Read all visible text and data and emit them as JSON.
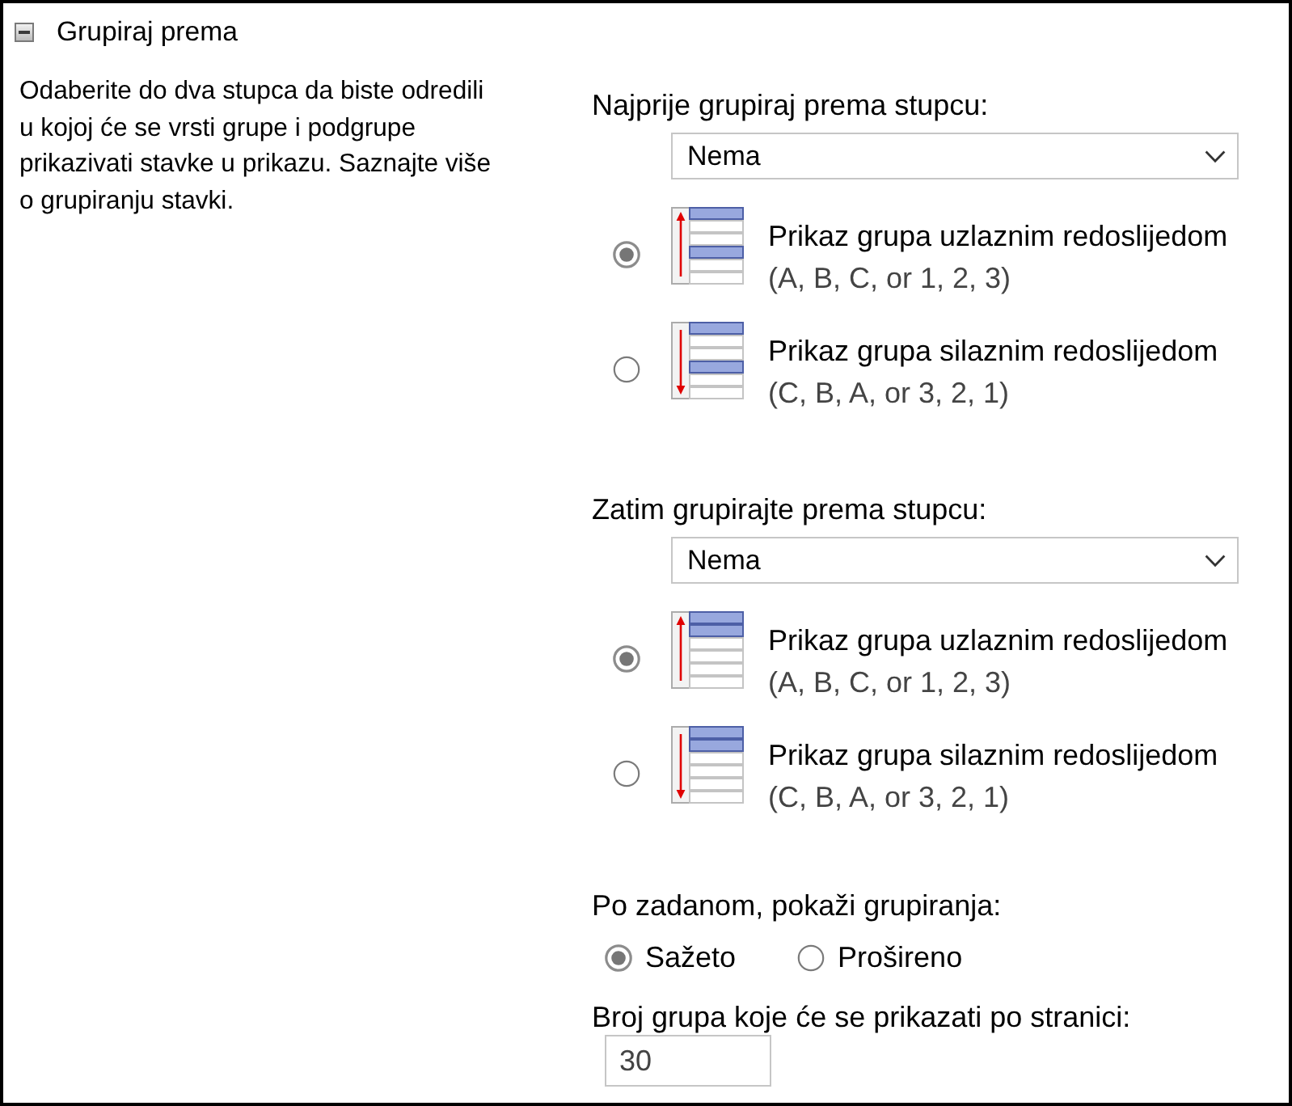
{
  "group": {
    "title": "Grupiraj prema",
    "expanded": true,
    "description": "Odaberite do dva stupca da biste odredili u kojoj će se vrsti grupe i podgrupe prikazivati stavke u prikazu. Saznajte više o grupiranju stavki."
  },
  "sections": [
    {
      "kind": "primary",
      "label": "Najprije grupiraj prema stupcu:",
      "dropdown": {
        "value": "Nema"
      },
      "options": [
        {
          "kind": "ascending",
          "selected": true,
          "label": "Prikaz grupa uzlaznim redoslijedom",
          "hint": "(A, B, C, or 1, 2, 3)"
        },
        {
          "kind": "descending",
          "selected": false,
          "label": "Prikaz grupa silaznim redoslijedom",
          "hint": "(C, B, A, or 3, 2, 1)"
        }
      ]
    },
    {
      "kind": "secondary",
      "label": "Zatim grupirajte prema stupcu:",
      "dropdown": {
        "value": "Nema"
      },
      "options": [
        {
          "kind": "ascending",
          "selected": true,
          "label": "Prikaz grupa uzlaznim redoslijedom",
          "hint": "(A, B, C, or 1, 2, 3)"
        },
        {
          "kind": "descending",
          "selected": false,
          "label": "Prikaz grupa silaznim redoslijedom",
          "hint": "(C, B, A, or 3, 2, 1)"
        }
      ]
    }
  ],
  "default_display": {
    "label": "Po zadanom, pokaži grupiranja:",
    "options": [
      {
        "label": "Sažeto",
        "selected": true
      },
      {
        "label": "Prošireno",
        "selected": false
      }
    ]
  },
  "page_size": {
    "label": "Broj grupa koje će se prikazati po stranici:",
    "value": "30"
  }
}
